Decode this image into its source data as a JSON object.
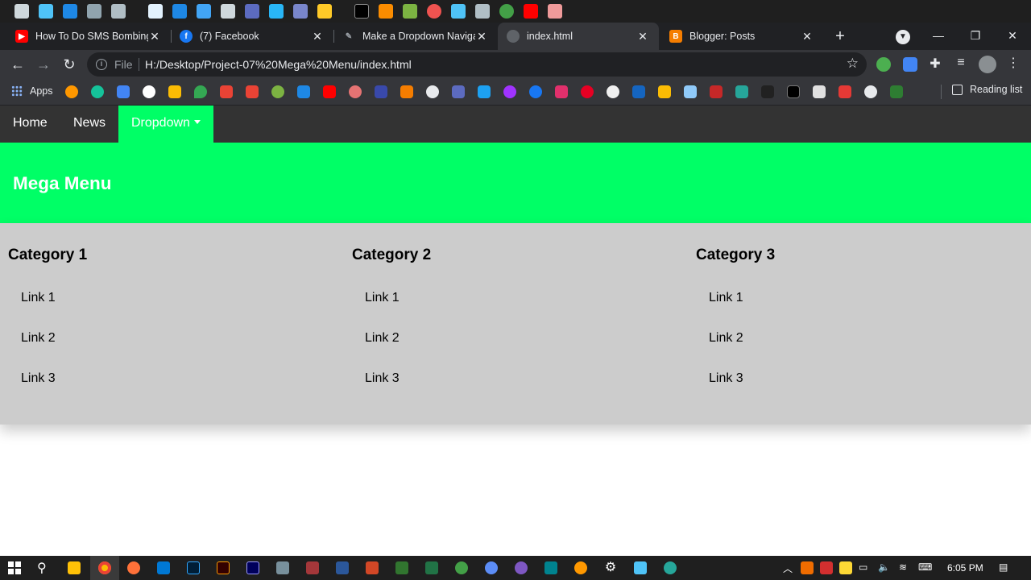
{
  "browser": {
    "tabs": [
      {
        "title": "How To Do SMS Bombing",
        "favicon": "youtube-icon",
        "color": "#ff0000",
        "active": false
      },
      {
        "title": "(7) Facebook",
        "favicon": "facebook-icon",
        "color": "#1877f2",
        "active": false
      },
      {
        "title": "Make a Dropdown Naviga",
        "favicon": "pen-icon",
        "color": "#35363a",
        "active": false
      },
      {
        "title": "index.html",
        "favicon": "globe-icon",
        "color": "#5f6368",
        "active": true
      },
      {
        "title": "Blogger: Posts",
        "favicon": "blogger-icon",
        "color": "#f57d00",
        "active": false
      }
    ],
    "address": {
      "scheme_label": "File",
      "url": "H:/Desktop/Project-07%20Mega%20Menu/index.html"
    },
    "bookmarks": {
      "apps_label": "Apps",
      "reading_list_label": "Reading list"
    }
  },
  "page": {
    "nav": {
      "home": "Home",
      "news": "News",
      "dropdown": "Dropdown"
    },
    "mega_menu": {
      "title": "Mega Menu",
      "columns": [
        {
          "title": "Category 1",
          "links": [
            "Link 1",
            "Link 2",
            "Link 3"
          ]
        },
        {
          "title": "Category 2",
          "links": [
            "Link 1",
            "Link 2",
            "Link 3"
          ]
        },
        {
          "title": "Category 3",
          "links": [
            "Link 1",
            "Link 2",
            "Link 3"
          ]
        }
      ]
    },
    "colors": {
      "accent": "#00ff66",
      "navbar": "#333333",
      "panel": "#cccccc"
    }
  },
  "taskbar": {
    "clock": "6:05 PM"
  }
}
